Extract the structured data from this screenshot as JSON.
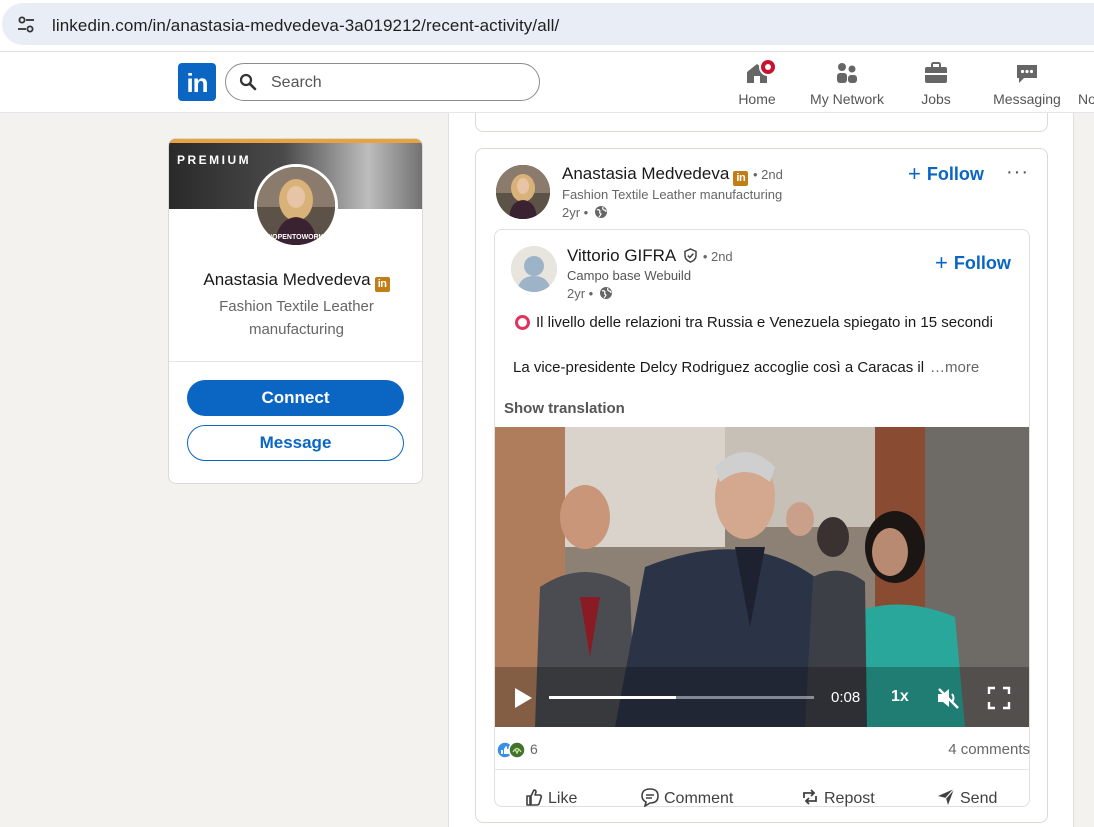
{
  "browser": {
    "url": "linkedin.com/in/anastasia-medvedeva-3a019212/recent-activity/all/",
    "site_settings_icon": "tune-icon"
  },
  "nav": {
    "logo_text": "in",
    "search_placeholder": "Search",
    "items": [
      {
        "label": "Home",
        "icon": "home-icon"
      },
      {
        "label": "My Network",
        "icon": "network-icon"
      },
      {
        "label": "Jobs",
        "icon": "briefcase-icon"
      },
      {
        "label": "Messaging",
        "icon": "messaging-icon"
      },
      {
        "label": "No",
        "icon": "bell-icon"
      }
    ]
  },
  "profile_card": {
    "badge": "PREMIUM",
    "name": "Anastasia Medvedeva",
    "name_badge": "in",
    "headline": "Fashion Textile Leather manufacturing",
    "avatar_frame_text": "#OPENTOWORK",
    "connect_label": "Connect",
    "message_label": "Message"
  },
  "post": {
    "author": "Anastasia Medvedeva",
    "author_badge": "in",
    "degree": "• 2nd",
    "headline": "Fashion Textile Leather manufacturing",
    "time": "2yr •",
    "follow_label": "Follow",
    "more_label": "···",
    "shared": {
      "author": "Vittorio GIFRA",
      "degree": "• 2nd",
      "headline": "Campo base Webuild",
      "time": "2yr •",
      "follow_label": "Follow",
      "text_line1": "Il livello delle relazioni tra Russia e Venezuela spiegato in 15 secondi",
      "text_line2": "La vice-presidente Delcy Rodriguez accoglie così a Caracas il",
      "more_text": "…more",
      "translate_label": "Show translation",
      "video": {
        "timecode": "0:08",
        "speed": "1x",
        "progress": 0.48,
        "muted": true
      }
    },
    "reactions_count": "6",
    "comments": "4 comments",
    "actions": {
      "like": "Like",
      "comment": "Comment",
      "repost": "Repost",
      "send": "Send"
    }
  },
  "colors": {
    "brand": "#0a66c2",
    "premium_gold": "#c37d16",
    "notification": "#cb112d",
    "page_bg": "#f4f2ee"
  }
}
